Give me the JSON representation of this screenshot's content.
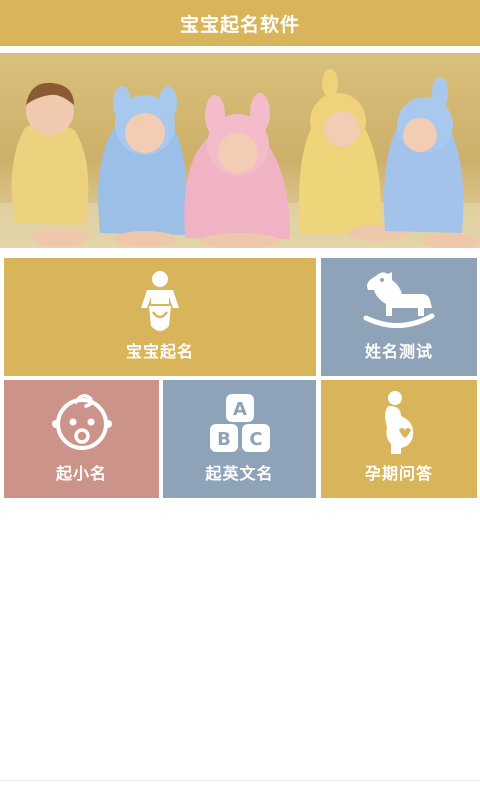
{
  "app": {
    "title": "宝宝起名软件"
  },
  "colors": {
    "gold": "#d8b45a",
    "blue": "#8fa3b8",
    "rose": "#cc938a"
  },
  "banner": {
    "image": "five babies in hooded towels photo"
  },
  "menu": [
    {
      "label": "宝宝起名",
      "icon": "baby-diaper-icon"
    },
    {
      "label": "姓名测试",
      "icon": "rocking-horse-icon"
    },
    {
      "label": "起小名",
      "icon": "baby-face-icon"
    },
    {
      "label": "起英文名",
      "icon": "abc-blocks-icon"
    },
    {
      "label": "孕期问答",
      "icon": "pregnant-woman-icon"
    }
  ]
}
